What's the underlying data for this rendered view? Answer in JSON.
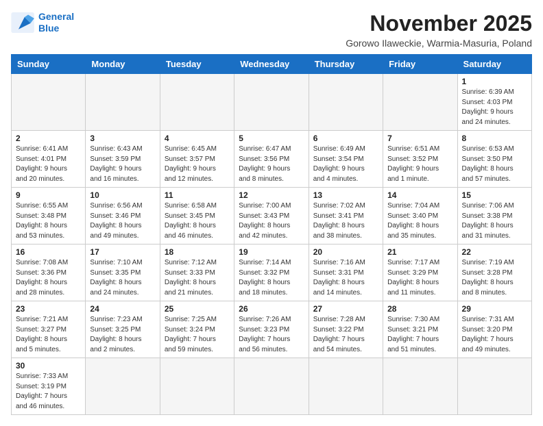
{
  "header": {
    "logo_line1": "General",
    "logo_line2": "Blue",
    "month": "November 2025",
    "location": "Gorowo Ilaweckie, Warmia-Masuria, Poland"
  },
  "weekdays": [
    "Sunday",
    "Monday",
    "Tuesday",
    "Wednesday",
    "Thursday",
    "Friday",
    "Saturday"
  ],
  "days": [
    {
      "date": "",
      "info": ""
    },
    {
      "date": "",
      "info": ""
    },
    {
      "date": "",
      "info": ""
    },
    {
      "date": "",
      "info": ""
    },
    {
      "date": "",
      "info": ""
    },
    {
      "date": "",
      "info": ""
    },
    {
      "date": "1",
      "info": "Sunrise: 6:39 AM\nSunset: 4:03 PM\nDaylight: 9 hours\nand 24 minutes."
    },
    {
      "date": "2",
      "info": "Sunrise: 6:41 AM\nSunset: 4:01 PM\nDaylight: 9 hours\nand 20 minutes."
    },
    {
      "date": "3",
      "info": "Sunrise: 6:43 AM\nSunset: 3:59 PM\nDaylight: 9 hours\nand 16 minutes."
    },
    {
      "date": "4",
      "info": "Sunrise: 6:45 AM\nSunset: 3:57 PM\nDaylight: 9 hours\nand 12 minutes."
    },
    {
      "date": "5",
      "info": "Sunrise: 6:47 AM\nSunset: 3:56 PM\nDaylight: 9 hours\nand 8 minutes."
    },
    {
      "date": "6",
      "info": "Sunrise: 6:49 AM\nSunset: 3:54 PM\nDaylight: 9 hours\nand 4 minutes."
    },
    {
      "date": "7",
      "info": "Sunrise: 6:51 AM\nSunset: 3:52 PM\nDaylight: 9 hours\nand 1 minute."
    },
    {
      "date": "8",
      "info": "Sunrise: 6:53 AM\nSunset: 3:50 PM\nDaylight: 8 hours\nand 57 minutes."
    },
    {
      "date": "9",
      "info": "Sunrise: 6:55 AM\nSunset: 3:48 PM\nDaylight: 8 hours\nand 53 minutes."
    },
    {
      "date": "10",
      "info": "Sunrise: 6:56 AM\nSunset: 3:46 PM\nDaylight: 8 hours\nand 49 minutes."
    },
    {
      "date": "11",
      "info": "Sunrise: 6:58 AM\nSunset: 3:45 PM\nDaylight: 8 hours\nand 46 minutes."
    },
    {
      "date": "12",
      "info": "Sunrise: 7:00 AM\nSunset: 3:43 PM\nDaylight: 8 hours\nand 42 minutes."
    },
    {
      "date": "13",
      "info": "Sunrise: 7:02 AM\nSunset: 3:41 PM\nDaylight: 8 hours\nand 38 minutes."
    },
    {
      "date": "14",
      "info": "Sunrise: 7:04 AM\nSunset: 3:40 PM\nDaylight: 8 hours\nand 35 minutes."
    },
    {
      "date": "15",
      "info": "Sunrise: 7:06 AM\nSunset: 3:38 PM\nDaylight: 8 hours\nand 31 minutes."
    },
    {
      "date": "16",
      "info": "Sunrise: 7:08 AM\nSunset: 3:36 PM\nDaylight: 8 hours\nand 28 minutes."
    },
    {
      "date": "17",
      "info": "Sunrise: 7:10 AM\nSunset: 3:35 PM\nDaylight: 8 hours\nand 24 minutes."
    },
    {
      "date": "18",
      "info": "Sunrise: 7:12 AM\nSunset: 3:33 PM\nDaylight: 8 hours\nand 21 minutes."
    },
    {
      "date": "19",
      "info": "Sunrise: 7:14 AM\nSunset: 3:32 PM\nDaylight: 8 hours\nand 18 minutes."
    },
    {
      "date": "20",
      "info": "Sunrise: 7:16 AM\nSunset: 3:31 PM\nDaylight: 8 hours\nand 14 minutes."
    },
    {
      "date": "21",
      "info": "Sunrise: 7:17 AM\nSunset: 3:29 PM\nDaylight: 8 hours\nand 11 minutes."
    },
    {
      "date": "22",
      "info": "Sunrise: 7:19 AM\nSunset: 3:28 PM\nDaylight: 8 hours\nand 8 minutes."
    },
    {
      "date": "23",
      "info": "Sunrise: 7:21 AM\nSunset: 3:27 PM\nDaylight: 8 hours\nand 5 minutes."
    },
    {
      "date": "24",
      "info": "Sunrise: 7:23 AM\nSunset: 3:25 PM\nDaylight: 8 hours\nand 2 minutes."
    },
    {
      "date": "25",
      "info": "Sunrise: 7:25 AM\nSunset: 3:24 PM\nDaylight: 7 hours\nand 59 minutes."
    },
    {
      "date": "26",
      "info": "Sunrise: 7:26 AM\nSunset: 3:23 PM\nDaylight: 7 hours\nand 56 minutes."
    },
    {
      "date": "27",
      "info": "Sunrise: 7:28 AM\nSunset: 3:22 PM\nDaylight: 7 hours\nand 54 minutes."
    },
    {
      "date": "28",
      "info": "Sunrise: 7:30 AM\nSunset: 3:21 PM\nDaylight: 7 hours\nand 51 minutes."
    },
    {
      "date": "29",
      "info": "Sunrise: 7:31 AM\nSunset: 3:20 PM\nDaylight: 7 hours\nand 49 minutes."
    },
    {
      "date": "30",
      "info": "Sunrise: 7:33 AM\nSunset: 3:19 PM\nDaylight: 7 hours\nand 46 minutes."
    },
    {
      "date": "",
      "info": ""
    },
    {
      "date": "",
      "info": ""
    },
    {
      "date": "",
      "info": ""
    },
    {
      "date": "",
      "info": ""
    },
    {
      "date": "",
      "info": ""
    },
    {
      "date": "",
      "info": ""
    }
  ]
}
